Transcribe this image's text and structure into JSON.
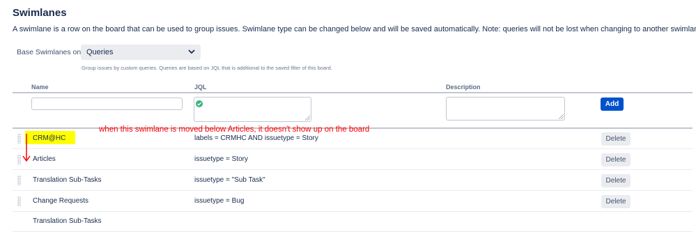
{
  "header": {
    "title": "Swimlanes",
    "description": "A swimlane is a row on the board that can be used to group issues. Swimlane type can be changed below and will be saved automatically. Note: queries will not be lost when changing to another swimlane type."
  },
  "base": {
    "label": "Base Swimlanes on",
    "selected": "Queries",
    "help": "Group issues by custom queries. Queries are based on JQL that is additional to the saved filter of this board."
  },
  "table": {
    "columns": {
      "name": "Name",
      "jql": "JQL",
      "description": "Description"
    },
    "add_label": "Add",
    "rows": [
      {
        "name": "CRM@HC",
        "jql": "labels = CRMHC AND issuetype = Story",
        "delete_label": "Delete"
      },
      {
        "name": "Articles",
        "jql": "issuetype = Story",
        "delete_label": "Delete"
      },
      {
        "name": "Translation Sub-Tasks",
        "jql": "issuetype = \"Sub Task\"",
        "delete_label": "Delete"
      },
      {
        "name": "Change Requests",
        "jql": "issuetype = Bug",
        "delete_label": "Delete"
      },
      {
        "name": "Translation Sub-Tasks"
      }
    ]
  },
  "annotation": {
    "text": "when this swimlane is moved below Articles, it doesn't show up on the board",
    "color": "#ff0000",
    "highlight_color": "#ffff00"
  },
  "colors": {
    "primary_button": "#0052cc",
    "valid": "#36b37e"
  },
  "icons": [
    "chevron-down-icon",
    "check-circle-icon",
    "drag-handle-icon",
    "annotation-arrow-icon"
  ]
}
